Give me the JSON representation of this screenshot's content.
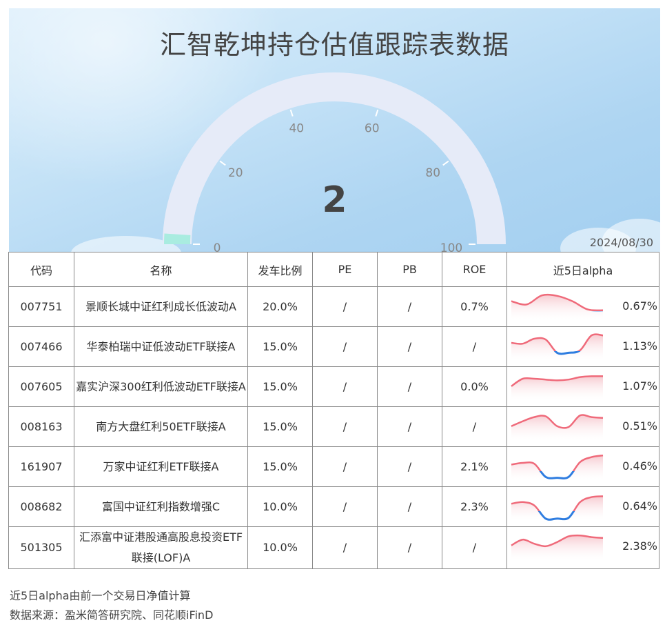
{
  "title": "汇智乾坤持仓估值跟踪表数据",
  "gauge": {
    "value": 2,
    "display": "2",
    "min": 0,
    "max": 100,
    "ticks": [
      "0",
      "20",
      "40",
      "60",
      "80",
      "100"
    ],
    "track_color": "#e6ebf8",
    "fill_color": "#a9ece0"
  },
  "date": "2024/08/30",
  "table": {
    "headers": [
      "代码",
      "名称",
      "发车比例",
      "PE",
      "PB",
      "ROE",
      "近5日alpha"
    ],
    "rows": [
      {
        "code": "007751",
        "name": "景顺长城中证红利成长低波动A",
        "ratio": "20.0%",
        "pe": "/",
        "pb": "/",
        "roe": "0.7%",
        "alpha": "0.67%",
        "spark": [
          0.6,
          0.4,
          0.95,
          0.92,
          0.6,
          0.1,
          0.05
        ]
      },
      {
        "code": "007466",
        "name": "华泰柏瑞中证低波动ETF联接A",
        "ratio": "15.0%",
        "pe": "/",
        "pb": "/",
        "roe": "/",
        "alpha": "1.13%",
        "spark": [
          0.5,
          0.45,
          0.75,
          0.7,
          -0.1,
          -0.1,
          0.05,
          0.95,
          0.95
        ]
      },
      {
        "code": "007605",
        "name": "嘉实沪深300红利低波动ETF联接A",
        "ratio": "15.0%",
        "pe": "/",
        "pb": "/",
        "roe": "0.0%",
        "alpha": "1.07%",
        "spark": [
          0.3,
          0.75,
          0.75,
          0.7,
          0.65,
          0.7,
          0.85,
          0.9,
          0.9
        ]
      },
      {
        "code": "008163",
        "name": "南方大盘红利50ETF联接A",
        "ratio": "15.0%",
        "pe": "/",
        "pb": "/",
        "roe": "/",
        "alpha": "0.51%",
        "spark": [
          0.3,
          0.6,
          0.85,
          0.9,
          0.3,
          0.25,
          0.95,
          0.85,
          0.8
        ]
      },
      {
        "code": "161907",
        "name": "万家中证红利ETF联接A",
        "ratio": "15.0%",
        "pe": "/",
        "pb": "/",
        "roe": "2.1%",
        "alpha": "0.46%",
        "spark": [
          0.4,
          0.5,
          0.45,
          -0.35,
          -0.4,
          -0.35,
          0.55,
          0.85,
          0.95
        ]
      },
      {
        "code": "008682",
        "name": "富国中证红利指数增强C",
        "ratio": "10.0%",
        "pe": "/",
        "pb": "/",
        "roe": "2.3%",
        "alpha": "0.64%",
        "spark": [
          0.45,
          0.55,
          0.35,
          -0.45,
          -0.45,
          -0.4,
          0.55,
          0.85,
          0.9
        ]
      },
      {
        "code": "501305",
        "name": "汇添富中证港股通高股息投资ETF联接(LOF)A",
        "ratio": "10.0%",
        "pe": "/",
        "pb": "/",
        "roe": "/",
        "alpha": "2.38%",
        "spark": [
          0.35,
          0.7,
          0.45,
          0.3,
          0.55,
          0.9,
          0.95,
          0.85,
          0.8
        ]
      }
    ]
  },
  "footer": {
    "note": "近5日alpha由前一个交易日净值计算",
    "source": "数据来源：盈米简答研究院、同花顺iFinD"
  },
  "colors": {
    "positive": "#ef6a7a",
    "negative": "#2f7de0",
    "positive_fill": "#f6c7cd"
  }
}
